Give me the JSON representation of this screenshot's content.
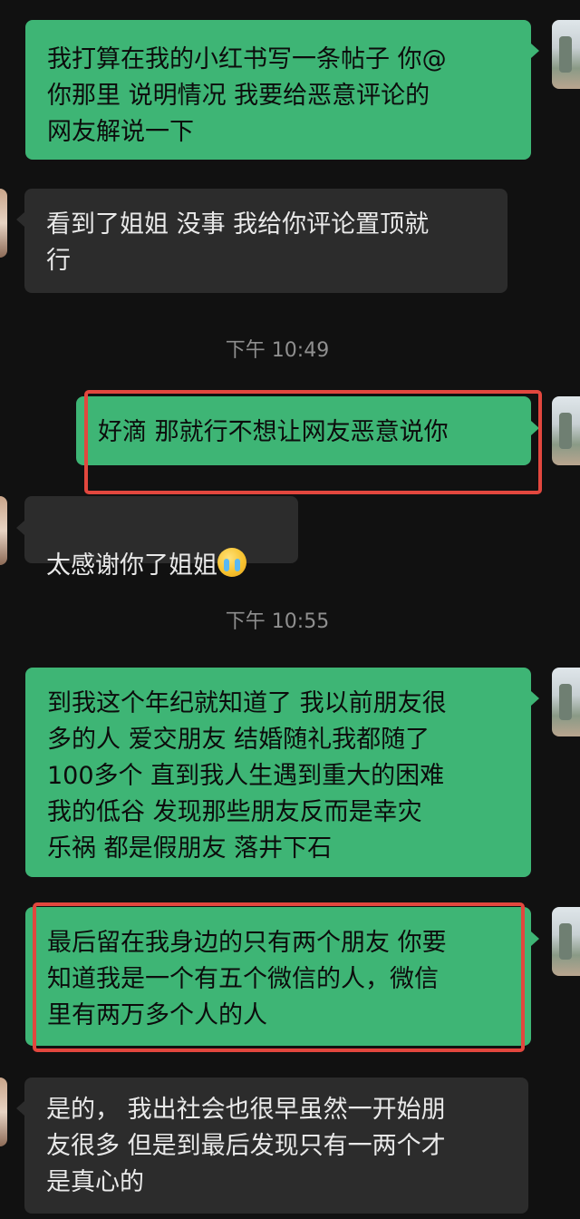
{
  "messages": [
    {
      "id": "m1",
      "direction": "sent",
      "text": "我打算在我的小红书写一条帖子 你@\n你那里 说明情况 我要给恶意评论的\n网友解说一下"
    },
    {
      "id": "m2",
      "direction": "received",
      "text": "看到了姐姐 没事 我给你评论置顶就\n行"
    },
    {
      "id": "t1",
      "type": "timestamp",
      "text": "下午 10:49"
    },
    {
      "id": "m3",
      "direction": "sent",
      "text": "好滴 那就行不想让网友恶意说你",
      "highlighted": true
    },
    {
      "id": "m4",
      "direction": "received",
      "text": "太感谢你了姐姐",
      "emoji": "crying-face-icon"
    },
    {
      "id": "t2",
      "type": "timestamp",
      "text": "下午 10:55"
    },
    {
      "id": "m5",
      "direction": "sent",
      "text": "到我这个年纪就知道了 我以前朋友很\n多的人 爱交朋友 结婚随礼我都随了\n100多个  直到我人生遇到重大的困难\n我的低谷  发现那些朋友反而是幸灾\n乐祸 都是假朋友 落井下石"
    },
    {
      "id": "m6",
      "direction": "sent",
      "text": "最后留在我身边的只有两个朋友 你要\n知道我是一个有五个微信的人，微信\n里有两万多个人的人",
      "highlighted": true
    },
    {
      "id": "m7",
      "direction": "received",
      "text": "是的， 我出社会也很早虽然一开始朋\n友很多 但是到最后发现只有一两个才\n是真心的"
    }
  ],
  "colors": {
    "background": "#111111",
    "sent_bubble": "#3eb575",
    "received_bubble": "#2c2c2c",
    "highlight_box": "#e2473e",
    "timestamp_text": "#8f8f8f"
  }
}
